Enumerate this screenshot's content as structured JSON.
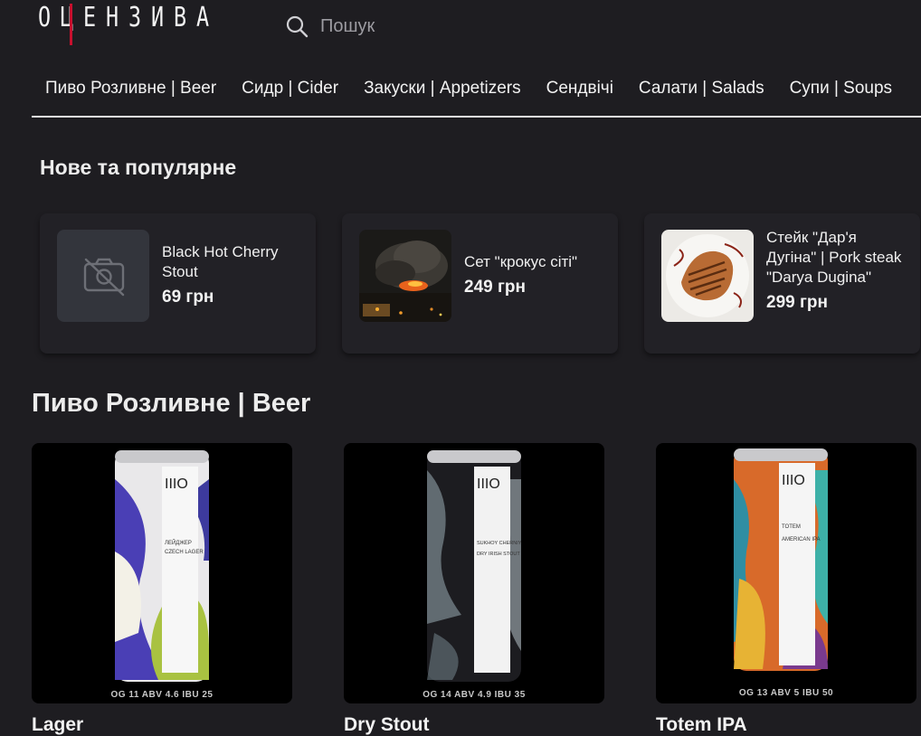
{
  "logo": {
    "text": "ОЦЕНЗИВА"
  },
  "search": {
    "placeholder": "Пошук"
  },
  "nav": {
    "items": [
      "Пиво Розливне | Beer",
      "Сидр | Cider",
      "Закуски | Appetizers",
      "Сендвічі",
      "Салати | Salads",
      "Супи | Soups"
    ]
  },
  "popular": {
    "title": "Нове та популярне",
    "items": [
      {
        "name": "Black Hot Cherry Stout",
        "price": "69 грн",
        "image": "no-image-icon"
      },
      {
        "name": "Сет \"крокус сіті\"",
        "price": "249 грн",
        "image": "night-fire-photo"
      },
      {
        "name": "Стейк \"Дар'я Дугіна\" | Pork steak \"Darya Dugina\"",
        "price": "299 грн",
        "image": "steak-plate-photo"
      }
    ]
  },
  "beer": {
    "title": "Пиво Розливне | Beer",
    "items": [
      {
        "name": "Lager",
        "spec": "OG 11  ABV 4.6  IBU 25",
        "can_label": "ЛЕЙДЖЕР CZECH LAGER"
      },
      {
        "name": "Dry Stout",
        "spec": "OG 14  ABV 4.9  IBU 35",
        "can_label": "SUKHOY CHERNIY DRY IRISH STOUT"
      },
      {
        "name": "Totem IPA",
        "spec": "OG 13  ABV 5  IBU 50",
        "can_label": "TOTEM AMERICAN IPA"
      }
    ]
  },
  "colors": {
    "background": "#1e1d21",
    "card": "#222126",
    "accent": "#c8102e"
  }
}
